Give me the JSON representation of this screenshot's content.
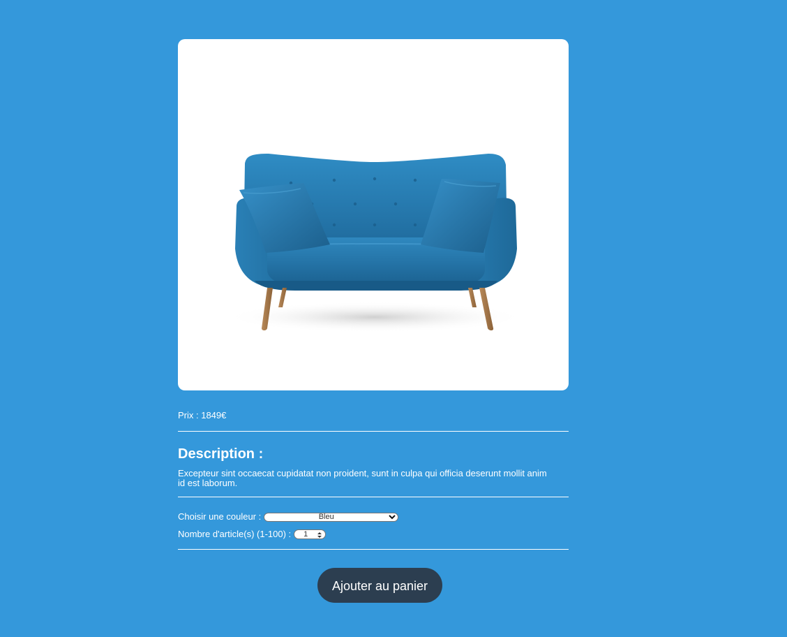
{
  "product": {
    "image_alt": "Canapé bleu",
    "price_label": "Prix : 1849€",
    "description": {
      "title": "Description :",
      "text": "Excepteur sint occaecat cupidatat non proident, sunt in culpa qui officia deserunt mollit anim id est laborum."
    },
    "options": {
      "color_label": "Choisir une couleur :",
      "color_selected": "Bleu",
      "quantity_label": "Nombre d'article(s) (1-100) :",
      "quantity_value": "1"
    },
    "add_to_cart_label": "Ajouter au panier"
  },
  "colors": {
    "background": "#3498db",
    "card": "#ffffff",
    "button": "#2c3e50",
    "sofa": "#2a7db0"
  },
  "icons": {
    "select_chevron": "chevron-down-icon",
    "stepper_spin": "spin-arrows-icon"
  }
}
